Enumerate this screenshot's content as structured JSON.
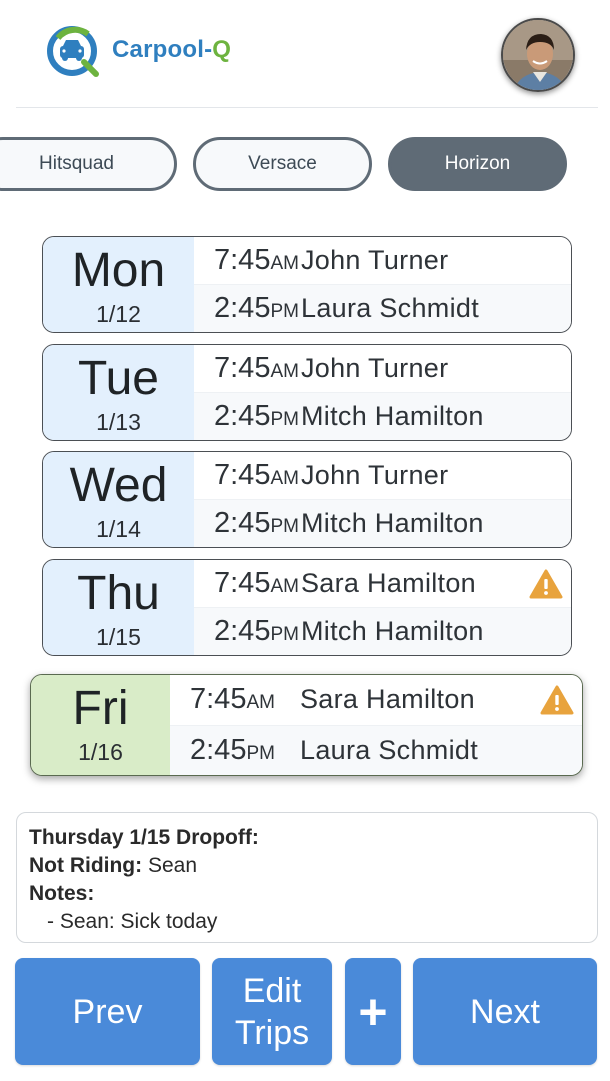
{
  "header": {
    "brand_part1": "Carpool-",
    "brand_part2": "Q",
    "accent_blue": "#2f7fbf",
    "accent_green": "#6db33f"
  },
  "groups": {
    "items": [
      {
        "label": "Hitsquad",
        "active": false
      },
      {
        "label": "Versace",
        "active": false
      },
      {
        "label": "Horizon",
        "active": true
      }
    ]
  },
  "schedule": {
    "days": [
      {
        "day": "Mon",
        "date": "1/12",
        "am_time": "7:45",
        "am_suffix": "AM",
        "am_driver": "John Turner",
        "pm_time": "2:45",
        "pm_suffix": "PM",
        "pm_driver": "Laura Schmidt",
        "warning": false
      },
      {
        "day": "Tue",
        "date": "1/13",
        "am_time": "7:45",
        "am_suffix": "AM",
        "am_driver": "John Turner",
        "pm_time": "2:45",
        "pm_suffix": "PM",
        "pm_driver": "Mitch Hamilton",
        "warning": false
      },
      {
        "day": "Wed",
        "date": "1/14",
        "am_time": "7:45",
        "am_suffix": "AM",
        "am_driver": "John Turner",
        "pm_time": "2:45",
        "pm_suffix": "PM",
        "pm_driver": "Mitch Hamilton",
        "warning": false
      },
      {
        "day": "Thu",
        "date": "1/15",
        "am_time": "7:45",
        "am_suffix": "AM",
        "am_driver": "Sara Hamilton",
        "pm_time": "2:45",
        "pm_suffix": "PM",
        "pm_driver": "Mitch Hamilton",
        "warning": true
      },
      {
        "day": "Fri",
        "date": "1/16",
        "am_time": "7:45",
        "am_suffix": "AM",
        "am_driver": "Sara Hamilton",
        "pm_time": "2:45",
        "pm_suffix": "PM",
        "pm_driver": "Laura Schmidt",
        "warning": true,
        "selected": true
      }
    ],
    "day_bg": "#e3f0fd",
    "selected_day_bg": "#d9ecc8",
    "warning_color": "#e8a33d"
  },
  "notes": {
    "title": "Thursday 1/15 Dropoff:",
    "not_riding_label": "Not Riding:",
    "not_riding_value": "Sean",
    "notes_label": "Notes:",
    "note_line": "- Sean: Sick today"
  },
  "actions": {
    "prev": "Prev",
    "edit": "Edit\nTrips",
    "add": "+",
    "next": "Next",
    "button_color": "#4a8ad9"
  }
}
